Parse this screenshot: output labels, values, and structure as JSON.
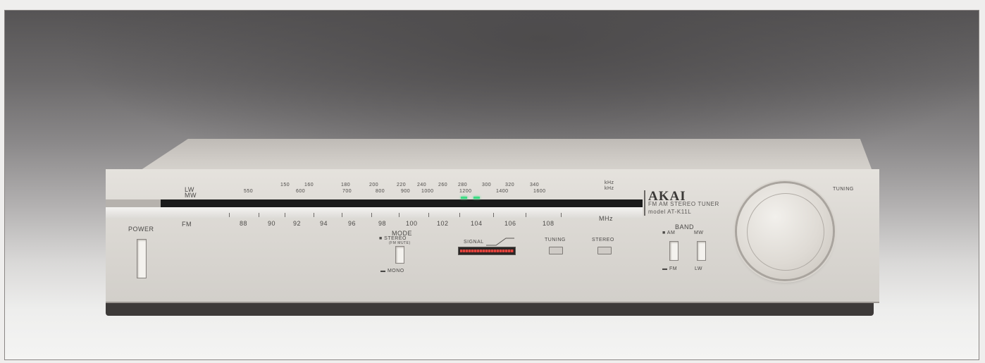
{
  "brand": "AKAI",
  "model_line1": "FM AM STEREO TUNER",
  "model_line2": "model AT-K11L",
  "band_labels": {
    "lw": "LW",
    "mw": "MW",
    "fm": "FM",
    "khz1": "kHz",
    "khz2": "kHz",
    "mhz": "MHz"
  },
  "lw_scale": [
    "150",
    "160",
    "180",
    "200",
    "220",
    "240",
    "260",
    "280",
    "300",
    "320",
    "340"
  ],
  "mw_scale": [
    "550",
    "600",
    "700",
    "800",
    "900",
    "1000",
    "1200",
    "1400",
    "1600"
  ],
  "fm_scale": [
    "88",
    "90",
    "92",
    "94",
    "96",
    "98",
    "100",
    "102",
    "104",
    "106",
    "108"
  ],
  "controls": {
    "power": "POWER",
    "mode": "MODE",
    "stereo": "■ STEREO",
    "fm_muting": "(FM MUTE)",
    "mono": "▬ MONO",
    "signal": "SIGNAL",
    "tuning_indicator": "TUNING",
    "stereo_indicator": "STEREO",
    "band": "BAND",
    "band_am": "■ AM",
    "band_mw": "MW",
    "band_fm": "▬ FM",
    "band_lw": "LW",
    "tuning_knob": "TUNING"
  },
  "colors": {
    "tuning_led": "#3ddc84",
    "signal_meter": "#e0453f",
    "panel": "#dcd9d4"
  }
}
